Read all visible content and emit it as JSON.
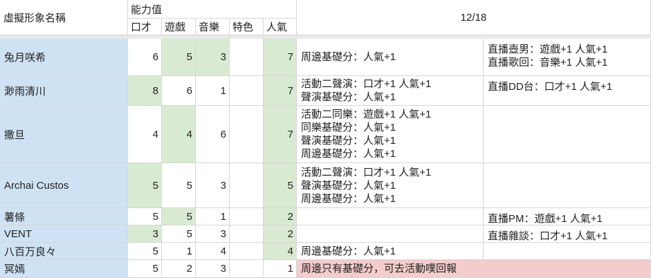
{
  "header": {
    "name_col": "虛擬形象名稱",
    "ability_group": "能力值",
    "cols": [
      "口才",
      "遊戲",
      "音樂",
      "特色",
      "人氣"
    ],
    "date": "12/18"
  },
  "rows": [
    {
      "name": "兔月咲希",
      "v": [
        "6",
        "5",
        "3",
        "",
        "7"
      ],
      "note1": "周邊基礎分：人氣+1",
      "note2": "直播壺男：遊戲+1 人氣+1\n直播歌回：音樂+1 人氣+1"
    },
    {
      "name": "渺雨清川",
      "v": [
        "8",
        "6",
        "1",
        "",
        "7"
      ],
      "note1": "活動二聲演：口才+1 人氣+1\n聲演基礎分：人氣+1",
      "note2": "直播DD台：口才+1 人氣+1"
    },
    {
      "name": "撒旦",
      "v": [
        "4",
        "4",
        "6",
        "",
        "7"
      ],
      "note1": "活動二同樂：遊戲+1 人氣+1\n同樂基礎分：人氣+1\n聲演基礎分：人氣+1\n周邊基礎分：人氣+1",
      "note2": ""
    },
    {
      "name": "Archai Custos",
      "v": [
        "5",
        "5",
        "3",
        "",
        "5"
      ],
      "note1": "活動二聲演：口才+1 人氣+1\n聲演基礎分：人氣+1\n周邊基礎分：人氣+1",
      "note2": ""
    },
    {
      "name": "薯條",
      "v": [
        "5",
        "5",
        "1",
        "",
        "2"
      ],
      "note1": "",
      "note2": "直播PM：遊戲+1 人氣+1"
    },
    {
      "name": "VENT",
      "v": [
        "3",
        "5",
        "3",
        "",
        "2"
      ],
      "note1": "",
      "note2": "直播雜談：口才+1 人氣+1"
    },
    {
      "name": "八百万良々",
      "v": [
        "5",
        "1",
        "4",
        "",
        "4"
      ],
      "note1": "周邊基礎分：人氣+1",
      "note2": ""
    },
    {
      "name": "冥嫣",
      "v": [
        "5",
        "2",
        "3",
        "",
        "1"
      ],
      "note1": "周邊只有基礎分，可去活動噗回報",
      "note2": ""
    }
  ],
  "colors": {
    "name_bg": "#cfe2f3",
    "green": "#d9ead3",
    "red": "#f4cccc"
  }
}
